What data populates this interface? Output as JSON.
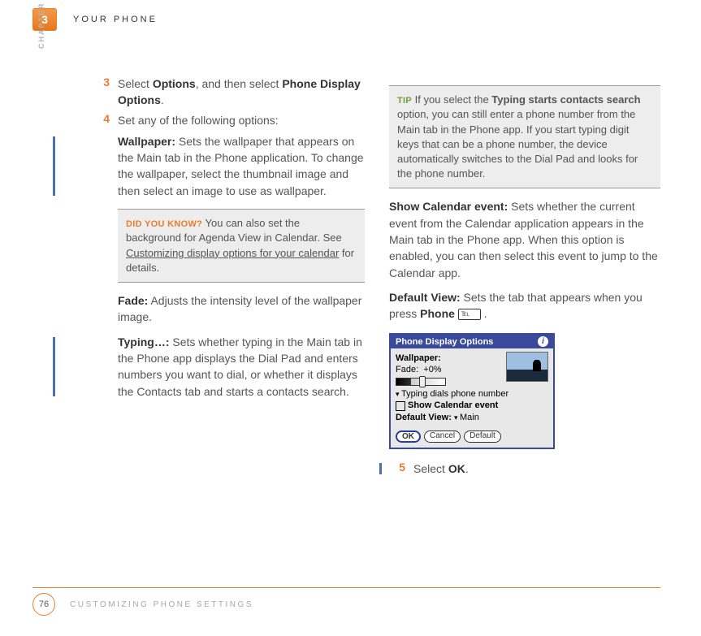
{
  "chapter": {
    "number": "3",
    "label": "CHAPTER",
    "running_head_title": "YOUR PHONE"
  },
  "footer": {
    "page_number": "76",
    "section_title": "CUSTOMIZING PHONE SETTINGS"
  },
  "left": {
    "step3_num": "3",
    "step3_text_a": "Select ",
    "step3_bold_a": "Options",
    "step3_text_b": ", and then select ",
    "step3_bold_b": "Phone Display Options",
    "step3_text_c": ".",
    "step4_num": "4",
    "step4_intro": "Set any of the following options:",
    "wallpaper_label": "Wallpaper:",
    "wallpaper_text": " Sets the wallpaper that appears on the Main tab in the Phone application. To change the wallpaper, select the thumbnail image and then select an image to use as wallpaper.",
    "dyk_label": "DID YOU KNOW?",
    "dyk_text_a": " You can also set the background for Agenda View in Calendar. See ",
    "dyk_link": "Customizing display options for your calendar",
    "dyk_text_b": " for details.",
    "fade_label": "Fade:",
    "fade_text": " Adjusts the intensity level of the wallpaper image.",
    "typing_label": "Typing…:",
    "typing_text": " Sets whether typing in the Main tab in the Phone app displays the Dial Pad and enters numbers you want to dial, or whether it displays the Contacts tab and starts a contacts search."
  },
  "right": {
    "tip_label": "TIP",
    "tip_text_a": " If you select the ",
    "tip_bold": "Typing starts contacts search",
    "tip_text_b": " option, you can still enter a phone number from the Main tab in the Phone app. If you start typing digit keys that can be a phone number, the device automatically switches to the Dial Pad and looks for the phone number.",
    "cal_label": "Show Calendar event:",
    "cal_text": " Sets whether the current event from the Calendar application appears in the Main tab in the Phone app. When this option is enabled, you can then select this event to jump to the Calendar app.",
    "def_label": "Default View:",
    "def_text_a": " Sets the tab that appears when you press ",
    "def_bold": "Phone",
    "def_text_b": " .",
    "phone_glyph": "℡",
    "step5_num": "5",
    "step5_text_a": "Select ",
    "step5_bold": "OK",
    "step5_text_b": "."
  },
  "screenshot": {
    "title": "Phone Display Options",
    "wallpaper_label": "Wallpaper:",
    "fade_label": "Fade:",
    "fade_value": "+0%",
    "typing_option": "Typing dials phone number",
    "show_cal": "Show Calendar event",
    "default_view_label": "Default View:",
    "default_view_value": "Main",
    "btn_ok": "OK",
    "btn_cancel": "Cancel",
    "btn_default": "Default"
  }
}
